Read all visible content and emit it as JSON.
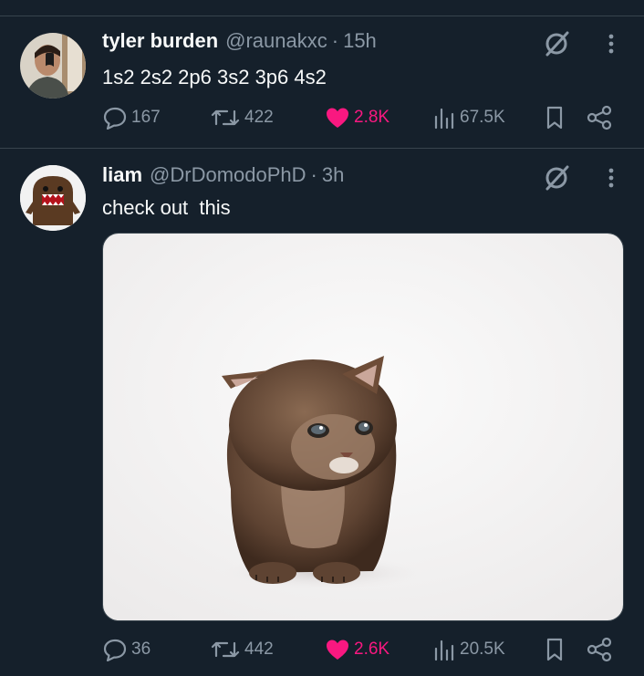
{
  "tweets": [
    {
      "display_name": "tyler burden",
      "handle": "@raunakxc",
      "separator": "·",
      "time": "15h",
      "text": "1s2 2s2 2p6 3s2 3p6 4s2",
      "replies": "167",
      "reposts": "422",
      "likes": "2.8K",
      "views": "67.5K",
      "liked": true
    },
    {
      "display_name": "liam",
      "handle": "@DrDomodoPhD",
      "separator": "·",
      "time": "3h",
      "text": "check out  this",
      "replies": "36",
      "reposts": "442",
      "likes": "2.6K",
      "views": "20.5K",
      "liked": true,
      "media_description": "kitten photo"
    }
  ],
  "colors": {
    "background": "#15202b",
    "divider": "#38444d",
    "secondary_text": "#8b98a5",
    "like": "#f91880"
  }
}
